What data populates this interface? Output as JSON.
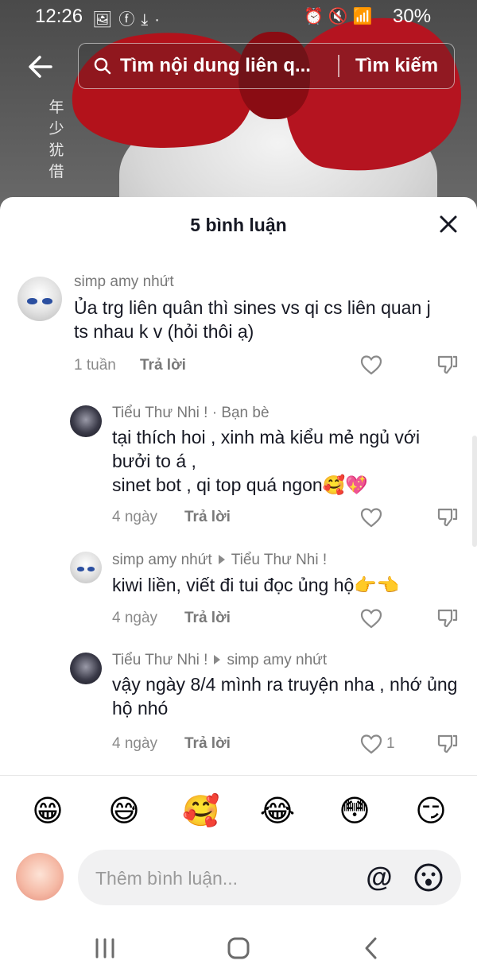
{
  "status": {
    "time": "12:26",
    "battery": "30%"
  },
  "background": {
    "vertical_text": "年少犹借"
  },
  "search": {
    "placeholder_text": "Tìm nội dung liên q...",
    "button_label": "Tìm kiếm"
  },
  "sheet": {
    "title": "5 bình luận"
  },
  "comments": [
    {
      "user": "simp amy nhứt",
      "text": "Ủa trg liên quân thì sines vs qi cs liên quan j ts nhau k v (hỏi thôi ạ)",
      "time": "1 tuần",
      "reply_label": "Trả lời"
    },
    {
      "user": "Tiểu Thư Nhi !",
      "user_suffix": " · Bạn bè",
      "text_lines": [
        "tại thích hoi , xinh mà kiểu mẻ ngủ với",
        "bưởi to á ,",
        "sinet bot , qi top quá ngon🥰💖"
      ],
      "time": "4 ngày",
      "reply_label": "Trả lời"
    },
    {
      "user": "simp amy nhứt",
      "reply_to": "Tiểu Thư Nhi !",
      "text": "kiwi liền, viết đi tui đọc ủng hộ👉👈",
      "time": "4 ngày",
      "reply_label": "Trả lời"
    },
    {
      "user": "Tiểu Thư Nhi !",
      "reply_to": "simp amy nhứt",
      "text": "vậy ngày 8/4 mình ra truyện nha , nhớ ủng hộ nhó",
      "time": "4 ngày",
      "reply_label": "Trả lời",
      "likes": "1"
    }
  ],
  "emoji_bar": [
    "😁",
    "😅",
    "🥰",
    "😂",
    "😳",
    "😏"
  ],
  "composer": {
    "placeholder": "Thêm bình luận...",
    "mention_symbol": "@"
  },
  "colors": {
    "accent_red": "#b3121b",
    "text_primary": "#161823",
    "text_secondary": "#787878"
  }
}
